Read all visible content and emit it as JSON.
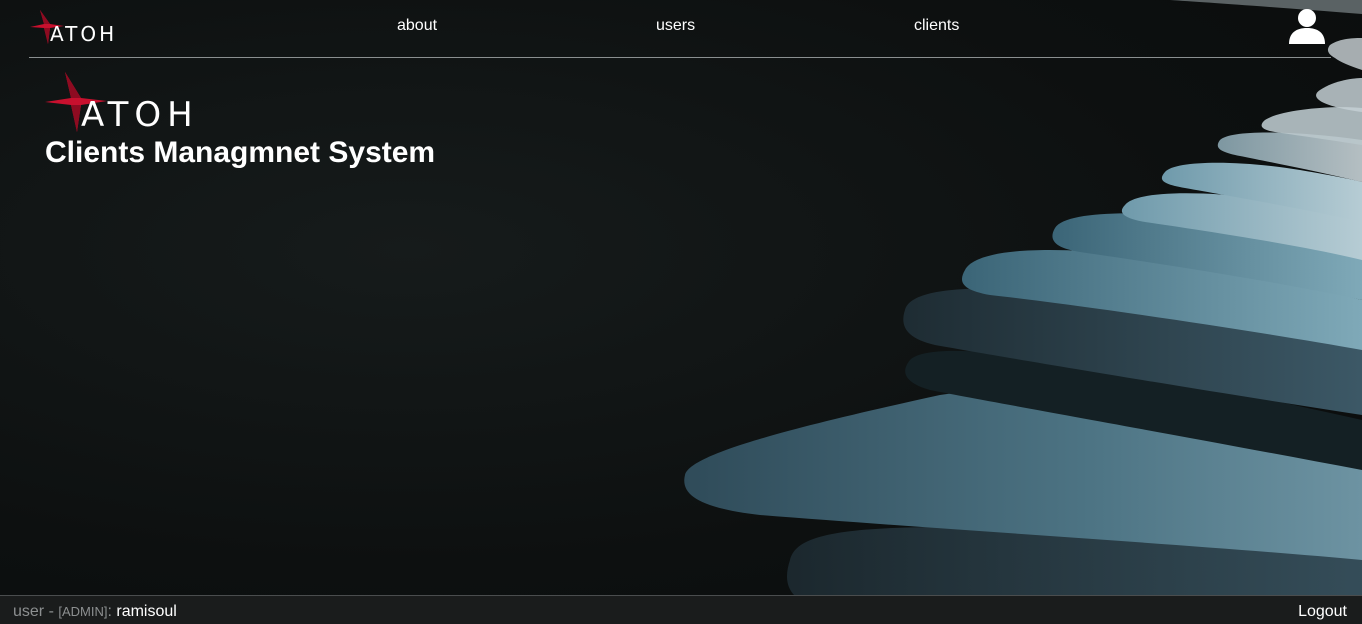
{
  "brand": {
    "logo_text": "ATOH",
    "accent_color": "#c8102e"
  },
  "nav": {
    "items": [
      {
        "label": "about"
      },
      {
        "label": "users"
      },
      {
        "label": "clients"
      }
    ],
    "profile_icon": "user-icon"
  },
  "hero": {
    "logo_text": "ATOH",
    "title": "Clients Managmnet System"
  },
  "footer": {
    "user_prefix": "user - ",
    "role": "[ADMIN]",
    "separator": ": ",
    "username": "ramisoul",
    "logout_label": "Logout"
  }
}
